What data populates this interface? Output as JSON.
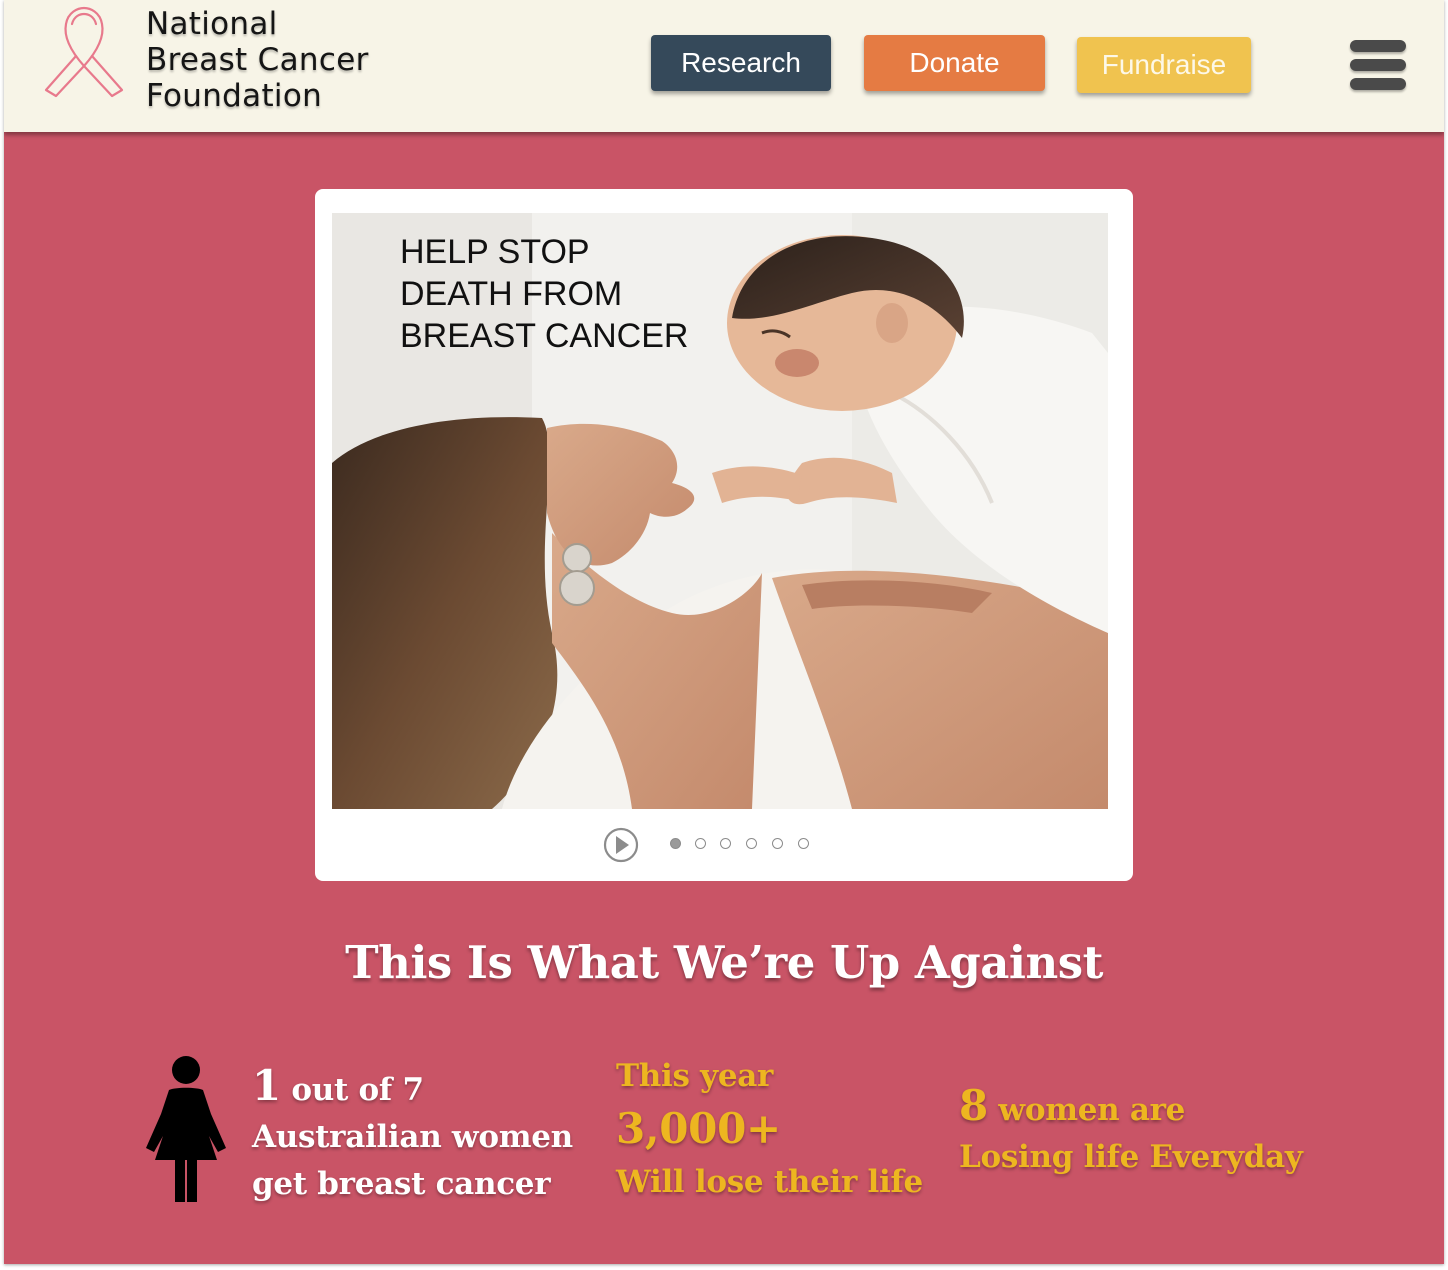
{
  "header": {
    "brand_lines": [
      "National",
      "Breast Cancer",
      "Foundation"
    ],
    "nav": {
      "research_label": "Research",
      "donate_label": "Donate",
      "fundraise_label": "Fundraise"
    },
    "menu_icon": "hamburger-menu-icon"
  },
  "colors": {
    "page_bg": "#c95466",
    "header_bg": "#f7f4e7",
    "research_btn": "#35495a",
    "donate_btn": "#e57b43",
    "fundraise_btn": "#f0c34f",
    "stat_accent": "#edb620"
  },
  "carousel": {
    "slide_text_lines": [
      "HELP STOP",
      "DEATH FROM",
      "BREAST CANCER"
    ],
    "slide_count": 6,
    "active_slide": 1,
    "play_icon": "play-circle-icon"
  },
  "stats": {
    "title": "This Is What We’re Up Against",
    "stat1": {
      "number": "1",
      "rest": " out of 7",
      "line2": "Austrailian women",
      "line3": "get breast cancer",
      "icon": "woman-figure-icon"
    },
    "stat2": {
      "line1": "This year",
      "number": "3,000+",
      "line3": "Will lose their life"
    },
    "stat3": {
      "number": "8",
      "rest": " women are",
      "line2": "Losing life Everyday"
    }
  }
}
